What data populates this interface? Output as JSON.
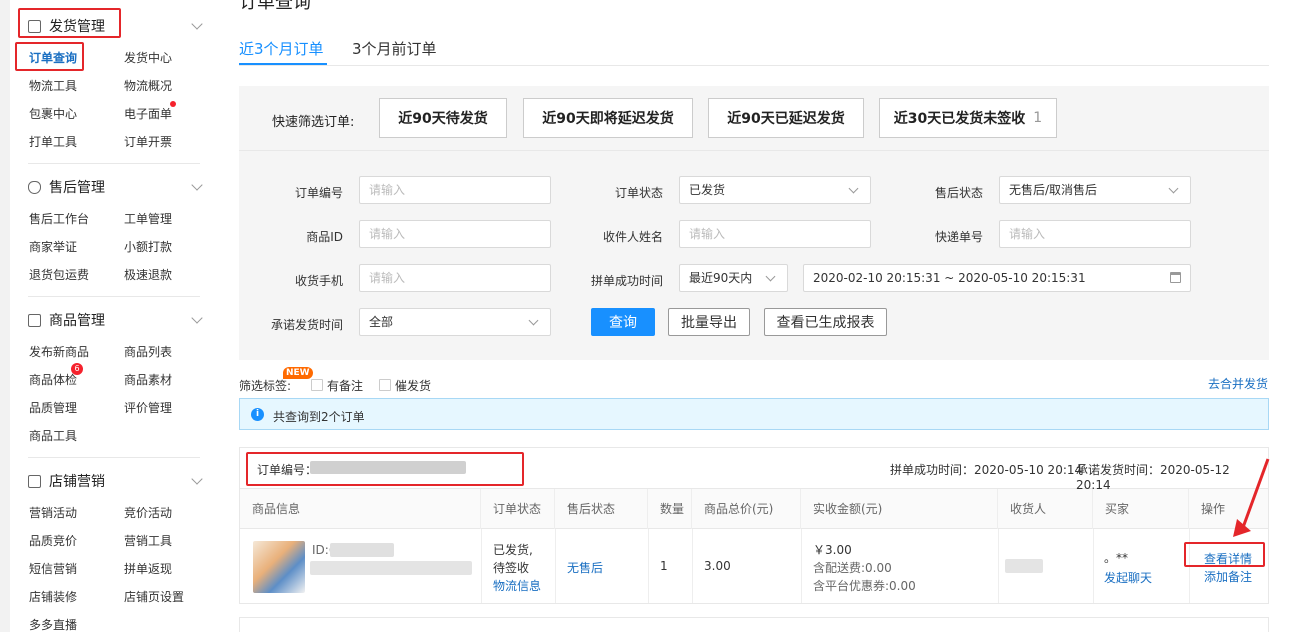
{
  "sidebar": {
    "sections": [
      {
        "title": "发货管理",
        "items": [
          "订单查询",
          "发货中心",
          "物流工具",
          "物流概况",
          "包裹中心",
          "电子面单",
          "打单工具",
          "订单开票"
        ]
      },
      {
        "title": "售后管理",
        "items": [
          "售后工作台",
          "工单管理",
          "商家举证",
          "小额打款",
          "退货包运费",
          "极速退款"
        ]
      },
      {
        "title": "商品管理",
        "items": [
          "发布新商品",
          "商品列表",
          "商品体检",
          "商品素材",
          "品质管理",
          "评价管理",
          "商品工具"
        ]
      },
      {
        "title": "店铺营销",
        "items": [
          "营销活动",
          "竞价活动",
          "品质竞价",
          "营销工具",
          "短信营销",
          "拼单返现",
          "店铺装修",
          "店铺页设置",
          "多多直播"
        ]
      }
    ],
    "badge_count": "6"
  },
  "page": {
    "title": "订单查询",
    "tabs": [
      "近3个月订单",
      "3个月前订单"
    ]
  },
  "quick_filter": {
    "label": "快速筛选订单:",
    "buttons": [
      "近90天待发货",
      "近90天即将延迟发货",
      "近90天已延迟发货",
      "近30天已发货未签收"
    ],
    "last_count": "1"
  },
  "form": {
    "order_no_label": "订单编号",
    "order_no_placeholder": "请输入",
    "order_status_label": "订单状态",
    "order_status_value": "已发货",
    "after_sale_label": "售后状态",
    "after_sale_value": "无售后/取消售后",
    "goods_id_label": "商品ID",
    "goods_id_placeholder": "请输入",
    "receiver_name_label": "收件人姓名",
    "receiver_name_placeholder": "请输入",
    "express_no_label": "快递单号",
    "express_no_placeholder": "请输入",
    "phone_label": "收货手机",
    "phone_placeholder": "请输入",
    "group_time_label": "拼单成功时间",
    "group_time_range": "最近90天内",
    "date_range": "2020-02-10 20:15:31 ~ 2020-05-10 20:15:31",
    "promise_label": "承诺发货时间",
    "promise_value": "全部",
    "query_button": "查询",
    "export_button": "批量导出",
    "report_button": "查看已生成报表"
  },
  "filter_tags": {
    "label": "筛选标签:",
    "new_badge": "NEW",
    "opt1": "有备注",
    "opt2": "催发货",
    "merge_link": "去合并发货"
  },
  "info": {
    "text": "共查询到2个订单"
  },
  "order": {
    "order_no_label": "订单编号：",
    "group_time": "拼单成功时间：2020-05-10 20:14",
    "promise_time": "承诺发货时间：2020-05-12 20:14",
    "columns": [
      "商品信息",
      "订单状态",
      "售后状态",
      "数量",
      "商品总价(元)",
      "实收金额(元)",
      "收货人",
      "买家",
      "操作"
    ],
    "goods_id_prefix": "ID:6",
    "status_line1": "已发货,",
    "status_line2": "待签收",
    "logistics_link": "物流信息",
    "after_sale": "无售后",
    "quantity": "1",
    "total": "3.00",
    "paid": "￥3.00",
    "shipping_fee": "含配送费:0.00",
    "coupon": "含平台优惠券:0.00",
    "buyer_name": "。**",
    "chat_link": "发起聊天",
    "detail_link": "查看详情",
    "note_link": "添加备注"
  },
  "colors": {
    "accent": "#1890ff",
    "annotation": "#e4262a"
  }
}
